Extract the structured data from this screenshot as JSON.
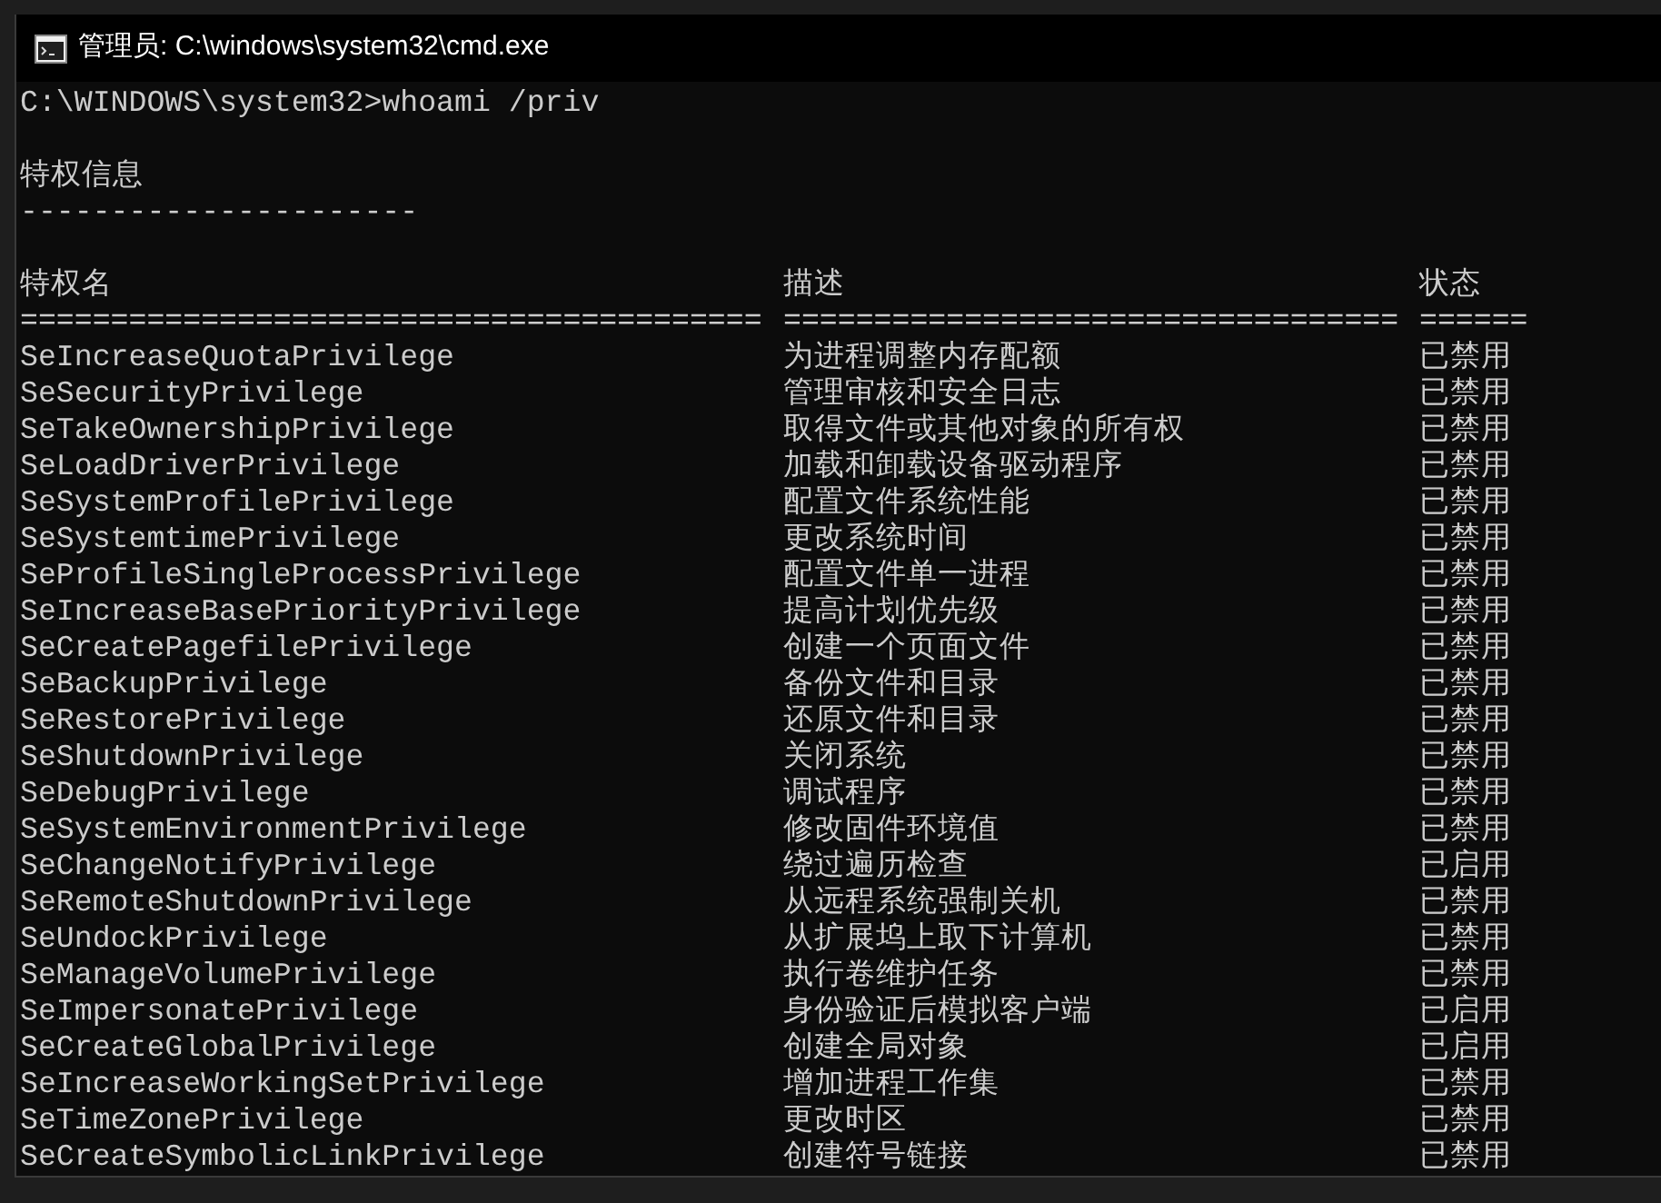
{
  "window": {
    "title": "管理员: C:\\windows\\system32\\cmd.exe"
  },
  "console": {
    "prompt": "C:\\WINDOWS\\system32>whoami /priv",
    "section_title": "特权信息",
    "section_rule": "----------------------",
    "columns": [
      "特权名",
      "描述",
      "状态"
    ],
    "column_rules": [
      "=========================================",
      "==================================",
      "======"
    ],
    "rows": [
      {
        "name": "SeIncreaseQuotaPrivilege",
        "description": "为进程调整内存配额",
        "status": "已禁用"
      },
      {
        "name": "SeSecurityPrivilege",
        "description": "管理审核和安全日志",
        "status": "已禁用"
      },
      {
        "name": "SeTakeOwnershipPrivilege",
        "description": "取得文件或其他对象的所有权",
        "status": "已禁用"
      },
      {
        "name": "SeLoadDriverPrivilege",
        "description": "加载和卸载设备驱动程序",
        "status": "已禁用"
      },
      {
        "name": "SeSystemProfilePrivilege",
        "description": "配置文件系统性能",
        "status": "已禁用"
      },
      {
        "name": "SeSystemtimePrivilege",
        "description": "更改系统时间",
        "status": "已禁用"
      },
      {
        "name": "SeProfileSingleProcessPrivilege",
        "description": "配置文件单一进程",
        "status": "已禁用"
      },
      {
        "name": "SeIncreaseBasePriorityPrivilege",
        "description": "提高计划优先级",
        "status": "已禁用"
      },
      {
        "name": "SeCreatePagefilePrivilege",
        "description": "创建一个页面文件",
        "status": "已禁用"
      },
      {
        "name": "SeBackupPrivilege",
        "description": "备份文件和目录",
        "status": "已禁用"
      },
      {
        "name": "SeRestorePrivilege",
        "description": "还原文件和目录",
        "status": "已禁用"
      },
      {
        "name": "SeShutdownPrivilege",
        "description": "关闭系统",
        "status": "已禁用"
      },
      {
        "name": "SeDebugPrivilege",
        "description": "调试程序",
        "status": "已禁用"
      },
      {
        "name": "SeSystemEnvironmentPrivilege",
        "description": "修改固件环境值",
        "status": "已禁用"
      },
      {
        "name": "SeChangeNotifyPrivilege",
        "description": "绕过遍历检查",
        "status": "已启用"
      },
      {
        "name": "SeRemoteShutdownPrivilege",
        "description": "从远程系统强制关机",
        "status": "已禁用"
      },
      {
        "name": "SeUndockPrivilege",
        "description": "从扩展坞上取下计算机",
        "status": "已禁用"
      },
      {
        "name": "SeManageVolumePrivilege",
        "description": "执行卷维护任务",
        "status": "已禁用"
      },
      {
        "name": "SeImpersonatePrivilege",
        "description": "身份验证后模拟客户端",
        "status": "已启用"
      },
      {
        "name": "SeCreateGlobalPrivilege",
        "description": "创建全局对象",
        "status": "已启用"
      },
      {
        "name": "SeIncreaseWorkingSetPrivilege",
        "description": "增加进程工作集",
        "status": "已禁用"
      },
      {
        "name": "SeTimeZonePrivilege",
        "description": "更改时区",
        "status": "已禁用"
      },
      {
        "name": "SeCreateSymbolicLinkPrivilege",
        "description": "创建符号链接",
        "status": "已禁用"
      }
    ]
  }
}
